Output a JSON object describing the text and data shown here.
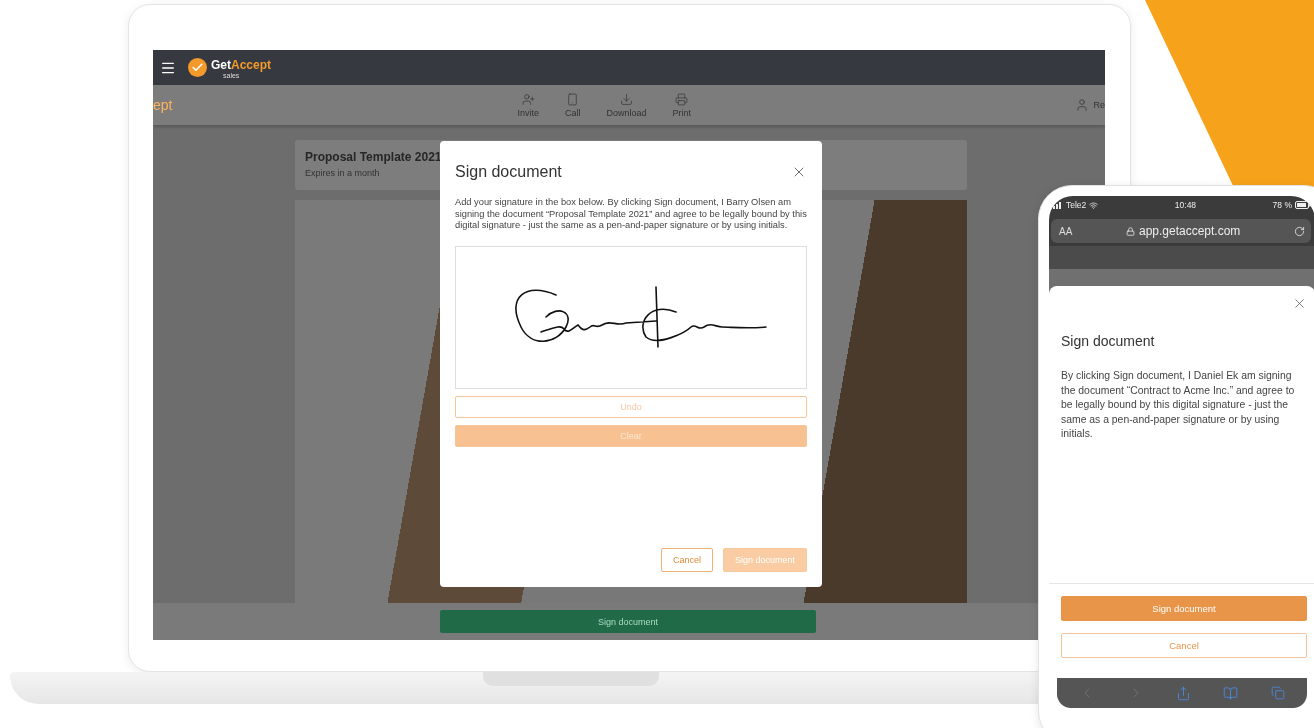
{
  "laptop": {
    "app_bar": {
      "logo": {
        "brand_first": "Get",
        "brand_second": "Accept",
        "tagline": "sales"
      }
    },
    "toolbar": {
      "left_title": "ept",
      "actions": [
        {
          "label": "Invite"
        },
        {
          "label": "Call"
        },
        {
          "label": "Download"
        },
        {
          "label": "Print"
        }
      ],
      "user_label": "Re"
    },
    "document": {
      "title": "Proposal Template 2021",
      "subtitle": "Expires in a month"
    },
    "sign_bar": {
      "button": "Sign document"
    },
    "modal": {
      "title": "Sign document",
      "body": "Add your signature in the box below. By clicking Sign document, I Barry Olsen am signing the document “Proposal Template 2021” and agree to be legally bound by this digital signature - just the same as a pen-and-paper signature or by using initials.",
      "undo": {
        "label": "Undo",
        "disabled": true
      },
      "clear": {
        "label": "Clear",
        "disabled": true
      },
      "cancel": {
        "label": "Cancel",
        "disabled": false
      },
      "confirm": {
        "label": "Sign document",
        "disabled": true
      }
    }
  },
  "phone": {
    "status_bar": {
      "carrier": "Tele2",
      "time": "10:48",
      "battery": "78 %"
    },
    "address_bar": {
      "text_size": "AA",
      "url": "app.getaccept.com"
    },
    "sheet": {
      "title": "Sign document",
      "body": "By clicking Sign document, I Daniel Ek am signing the document “Contract to Acme Inc.” and agree to be legally bound by this digital signature - just the same as a pen-and-paper signature or by using initials.",
      "confirm": {
        "label": "Sign document"
      },
      "cancel": {
        "label": "Cancel"
      }
    }
  }
}
